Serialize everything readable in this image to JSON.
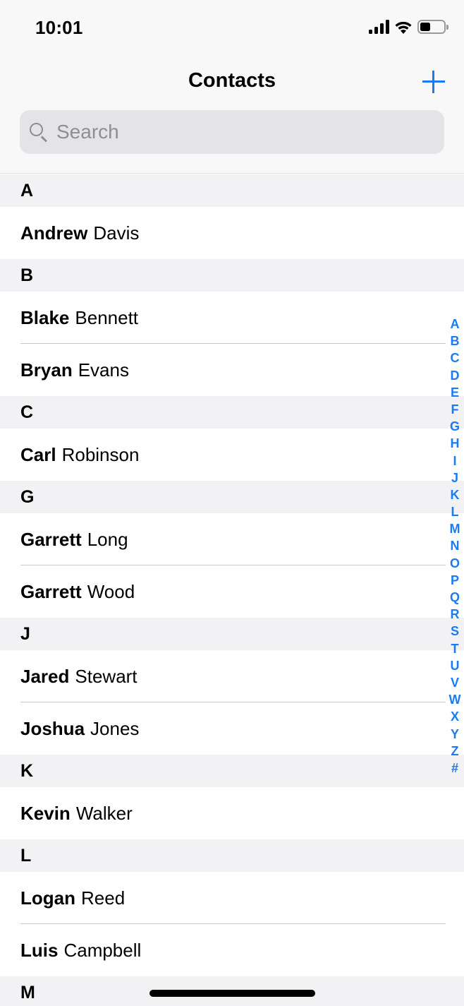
{
  "status_bar": {
    "time": "10:01",
    "icons": [
      "cellular-signal-icon",
      "wifi-icon",
      "battery-icon"
    ],
    "battery_level_percent": 45
  },
  "nav": {
    "title": "Contacts",
    "add_icon": "plus-icon"
  },
  "search": {
    "placeholder": "Search",
    "value": "",
    "icon": "magnifying-glass-icon"
  },
  "colors": {
    "accent": "#1a7cf0",
    "section_header_bg": "#f2f1f3",
    "search_bg": "#e4e4e8",
    "placeholder": "#8e8e93"
  },
  "sections": [
    {
      "letter": "A",
      "contacts": [
        {
          "first": "Andrew",
          "last": "Davis"
        }
      ]
    },
    {
      "letter": "B",
      "contacts": [
        {
          "first": "Blake",
          "last": "Bennett"
        },
        {
          "first": "Bryan",
          "last": "Evans"
        }
      ]
    },
    {
      "letter": "C",
      "contacts": [
        {
          "first": "Carl",
          "last": "Robinson"
        }
      ]
    },
    {
      "letter": "G",
      "contacts": [
        {
          "first": "Garrett",
          "last": "Long"
        },
        {
          "first": "Garrett",
          "last": "Wood"
        }
      ]
    },
    {
      "letter": "J",
      "contacts": [
        {
          "first": "Jared",
          "last": "Stewart"
        },
        {
          "first": "Joshua",
          "last": "Jones"
        }
      ]
    },
    {
      "letter": "K",
      "contacts": [
        {
          "first": "Kevin",
          "last": "Walker"
        }
      ]
    },
    {
      "letter": "L",
      "contacts": [
        {
          "first": "Logan",
          "last": "Reed"
        },
        {
          "first": "Luis",
          "last": "Campbell"
        }
      ]
    },
    {
      "letter": "M",
      "contacts": []
    }
  ],
  "index_letters": [
    "A",
    "B",
    "C",
    "D",
    "E",
    "F",
    "G",
    "H",
    "I",
    "J",
    "K",
    "L",
    "M",
    "N",
    "O",
    "P",
    "Q",
    "R",
    "S",
    "T",
    "U",
    "V",
    "W",
    "X",
    "Y",
    "Z",
    "#"
  ]
}
